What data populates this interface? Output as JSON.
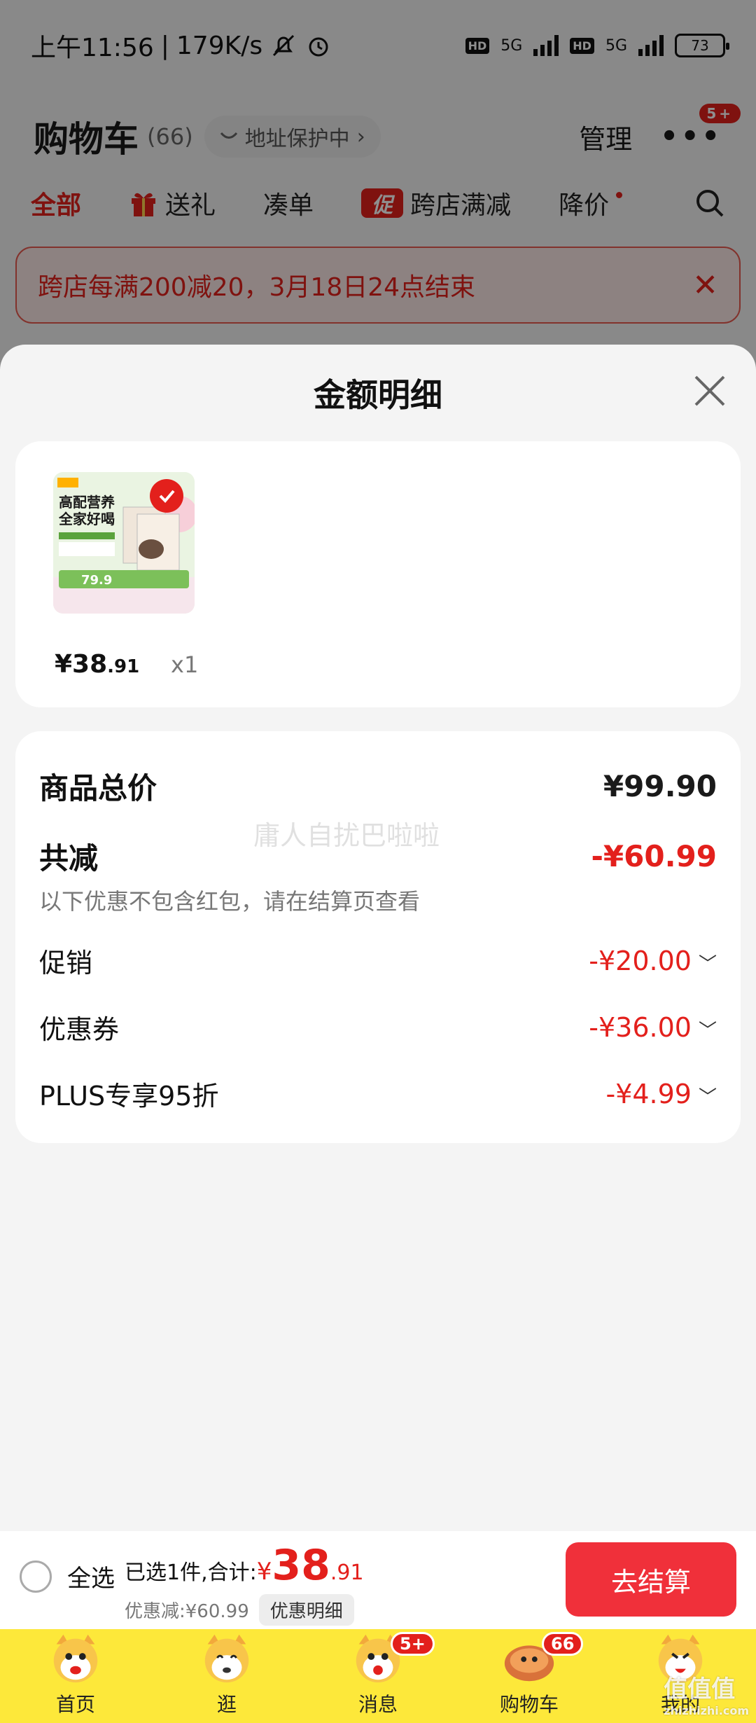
{
  "status": {
    "time": "上午11:56",
    "speed": "179K/s",
    "hd": "HD",
    "network": "5G",
    "battery": "73"
  },
  "header": {
    "title": "购物车",
    "count": "(66)",
    "address_pill": "地址保护中",
    "manage": "管理",
    "more_badge": "5+"
  },
  "tabs": [
    {
      "label": "全部"
    },
    {
      "label": "送礼"
    },
    {
      "label": "凑单"
    },
    {
      "label": "跨店满减",
      "tag": "促"
    },
    {
      "label": "降价"
    }
  ],
  "promo_banner": "跨店每满200减20，3月18日24点结束",
  "sheet": {
    "title": "金额明细",
    "product": {
      "price_int": "¥38",
      "price_dec": ".91",
      "qty": "x1",
      "image_text": {
        "headline1": "高配营养",
        "headline2": "全家好喝",
        "promo": "79.9"
      }
    },
    "summary": {
      "total_label": "商品总价",
      "total_value": "¥99.90",
      "discount_label": "共减",
      "discount_value": "-¥60.99",
      "note": "以下优惠不包含红包，请在结算页查看",
      "watermark": "庸人自扰巴啦啦",
      "items": [
        {
          "label": "促销",
          "value": "-¥20.00"
        },
        {
          "label": "优惠券",
          "value": "-¥36.00"
        },
        {
          "label": "PLUS专享95折",
          "value": "-¥4.99"
        }
      ]
    }
  },
  "checkout": {
    "select_all": "全选",
    "selected_text": "已选1件,合计:",
    "currency": "¥",
    "total_int": "38",
    "total_dec": ".91",
    "discount_text": "优惠减:¥60.99",
    "discount_detail": "优惠明细",
    "button": "去结算"
  },
  "tabbar": [
    {
      "label": "首页"
    },
    {
      "label": "逛"
    },
    {
      "label": "消息",
      "badge": "5+"
    },
    {
      "label": "购物车",
      "badge": "66"
    },
    {
      "label": "我的"
    }
  ],
  "site_mark": {
    "main": "值值值",
    "sub": "zhizhizhi.com"
  },
  "colors": {
    "accent": "#e3201c",
    "tabbar": "#fde83a",
    "checkout_button": "#f0303a"
  }
}
